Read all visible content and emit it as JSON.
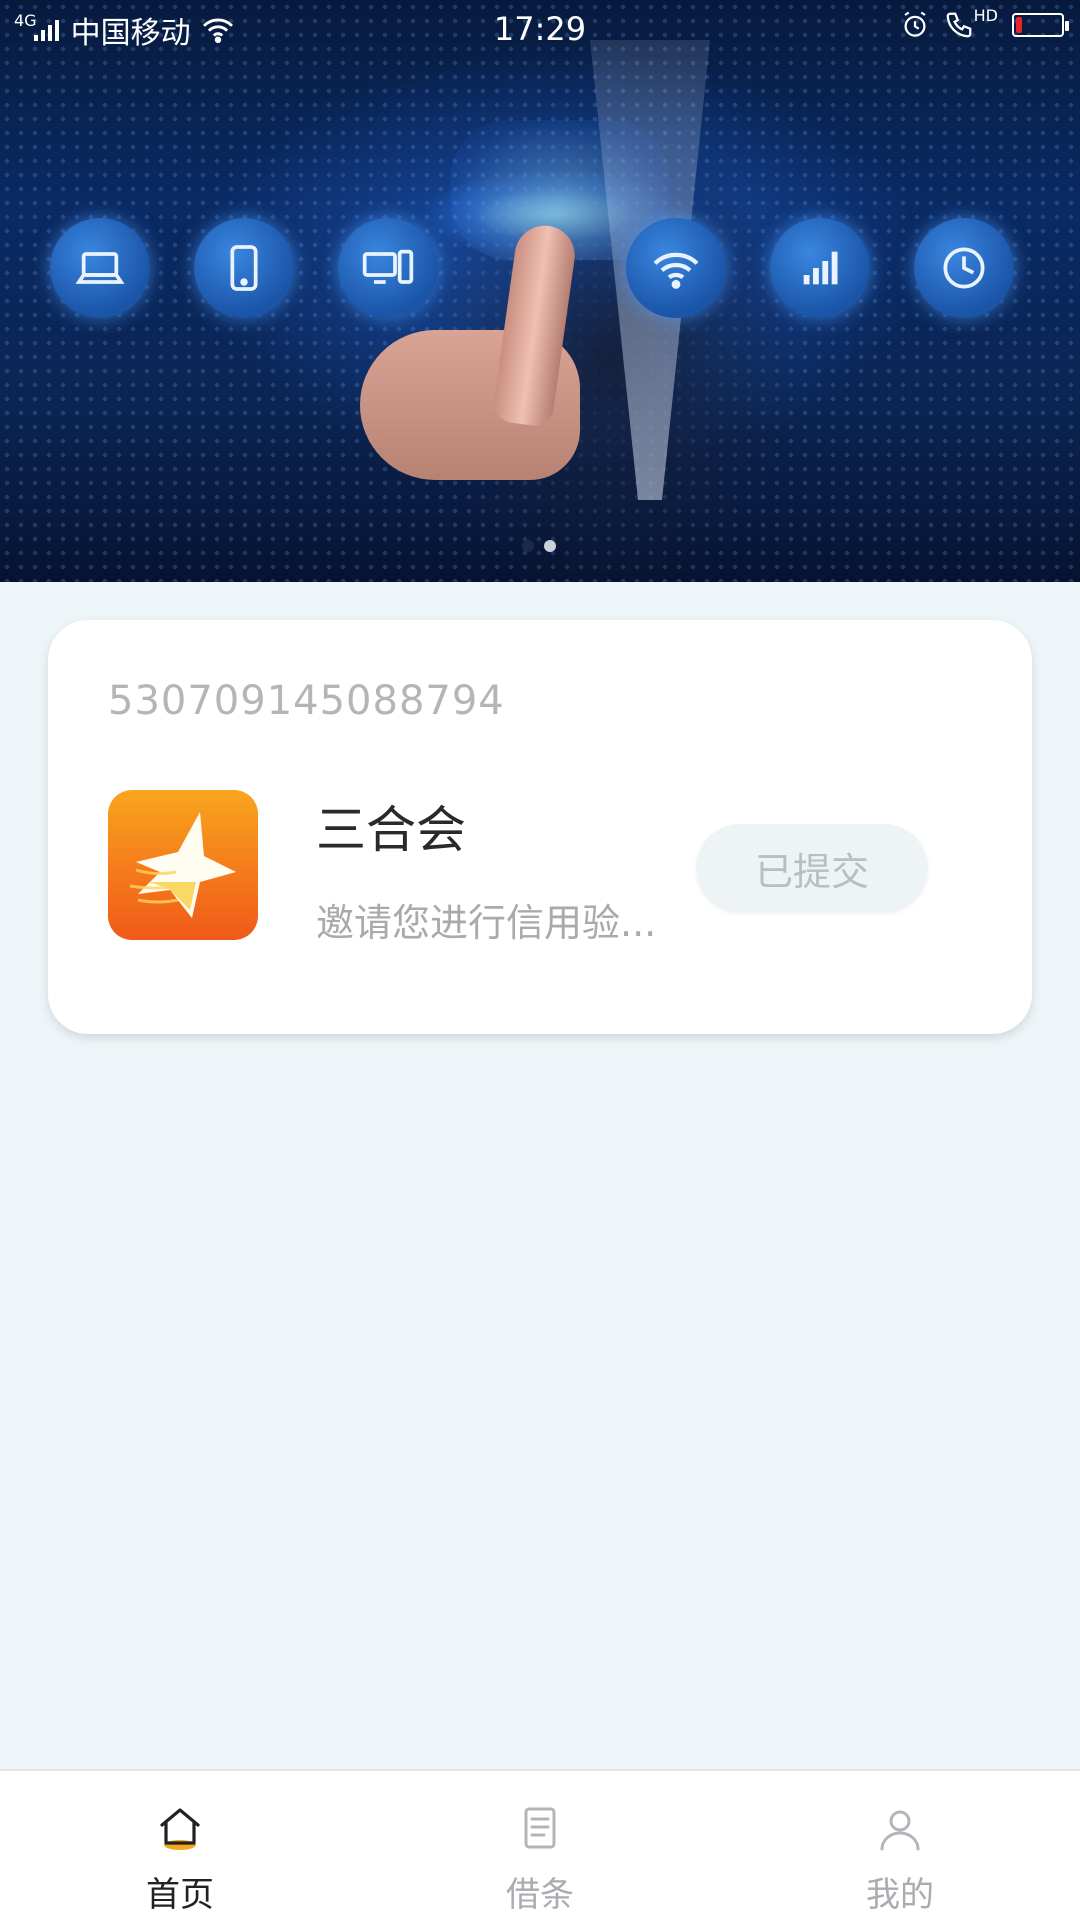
{
  "status_bar": {
    "network": "4G",
    "carrier": "中国移动",
    "time": "17:29",
    "hd": "HD",
    "battery_level": 0.12,
    "battery_color": "#e8242a"
  },
  "banner": {
    "icons": [
      "laptop-icon",
      "phone-icon",
      "computer-icon",
      "wifi-icon",
      "signal-icon",
      "clock-icon"
    ],
    "page_count": 2,
    "active_page": 1
  },
  "card": {
    "id_number": "530709145088794",
    "app_name": "三合会",
    "description": "邀请您进行信用验...",
    "button_label": "已提交"
  },
  "bottom_nav": {
    "items": [
      {
        "label": "首页",
        "icon": "home-icon",
        "active": true
      },
      {
        "label": "借条",
        "icon": "document-icon",
        "active": false
      },
      {
        "label": "我的",
        "icon": "user-icon",
        "active": false
      }
    ]
  },
  "colors": {
    "accent": "#f5a623",
    "page_background": "#eef5f8"
  }
}
